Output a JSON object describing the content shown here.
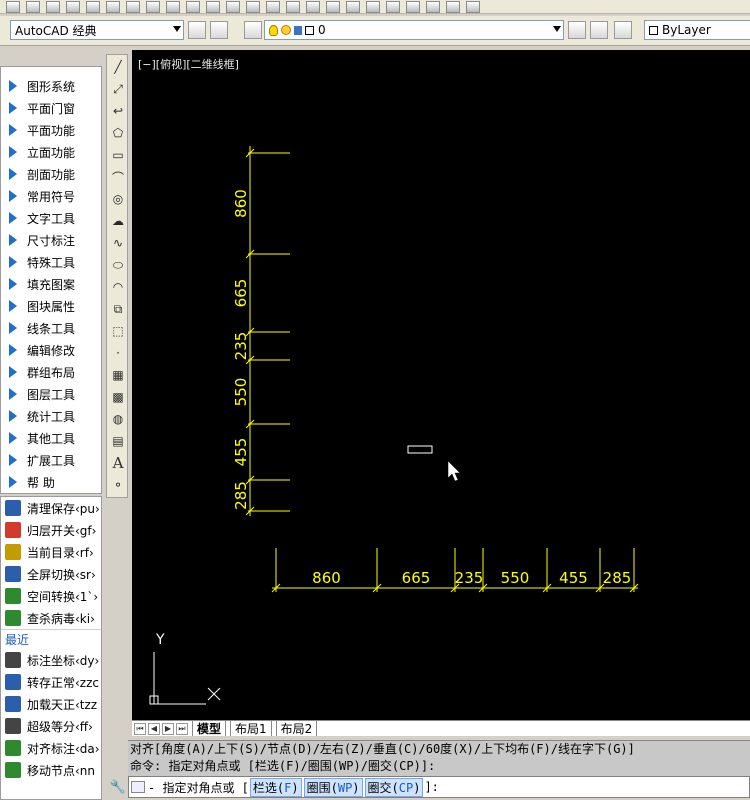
{
  "workspace": {
    "name": "AutoCAD 经典"
  },
  "layer": {
    "name": "0"
  },
  "color_control": {
    "value": "ByLayer"
  },
  "view_label": "[−][俯视][二维线框]",
  "left_menu": {
    "items": [
      "图形系统",
      "平面门窗",
      "平面功能",
      "立面功能",
      "剖面功能",
      "常用符号",
      "文字工具",
      "尺寸标注",
      "特殊工具",
      "填充图案",
      "图块属性",
      "线条工具",
      "编辑修改",
      "群组布局",
      "图层工具",
      "统计工具",
      "其他工具",
      "扩展工具",
      "帮    助"
    ]
  },
  "tools_panel": {
    "items": [
      {
        "label": "清理保存‹pu›",
        "icon": "save-clean-icon",
        "color": "#2b5fae"
      },
      {
        "label": "归层开关‹gf›",
        "icon": "layers-icon",
        "color": "#d23a2a"
      },
      {
        "label": "当前目录‹rf›",
        "icon": "dwg-icon",
        "color": "#c49b00"
      },
      {
        "label": "全屏切换‹sr›",
        "icon": "fullscreen-icon",
        "color": "#2b5fae"
      },
      {
        "label": "空间转换‹1`›",
        "icon": "space-switch-icon",
        "color": "#2f8a2f"
      },
      {
        "label": "查杀病毒‹ki›",
        "icon": "shield-icon",
        "color": "#2f8a2f"
      }
    ],
    "recent_label": "最近",
    "recent_items": [
      {
        "label": "标注坐标‹dy›",
        "icon": "coordinate-icon",
        "color": "#444444"
      },
      {
        "label": "转存正常‹zzc",
        "icon": "convert-icon",
        "color": "#2b5fae"
      },
      {
        "label": "加载天正‹tzz",
        "icon": "load-icon",
        "color": "#2b5fae"
      },
      {
        "label": "超级等分‹ff›",
        "icon": "divide-icon",
        "color": "#444444"
      },
      {
        "label": "对齐标注‹da›",
        "icon": "align-dim-icon",
        "color": "#2f8a2f"
      },
      {
        "label": "移动节点‹nn",
        "icon": "move-node-icon",
        "color": "#2f8a2f"
      }
    ]
  },
  "drawing": {
    "vertical_dims": [
      "860",
      "665",
      "235",
      "550",
      "455",
      "285"
    ],
    "horizontal_dims": [
      "860",
      "665",
      "235",
      "550",
      "455",
      "285"
    ],
    "ucs_y": "Y",
    "ucs_x": "X"
  },
  "tabs": [
    "模型",
    "布局1",
    "布局2"
  ],
  "command": {
    "line1": "对齐[角度(A)/上下(S)/节点(D)/左右(Z)/垂直(C)/60度(X)/上下均布(F)/线在字下(G)]",
    "line2": "命令: 指定对角点或 [栏选(F)/圈围(WP)/圈交(CP)]:",
    "prompt_prefix": "- 指定对角点或 [",
    "kw1_text": "栏选(",
    "kw1_key": "F",
    "kw2_text": "圈围(",
    "kw2_key": "WP",
    "kw3_text": "圈交(",
    "kw3_key": "CP",
    "prompt_suffix": "]:"
  },
  "colors": {
    "dimension": "#ffff00",
    "canvas": "#000000",
    "accent_blue": "#1f6fd1"
  }
}
